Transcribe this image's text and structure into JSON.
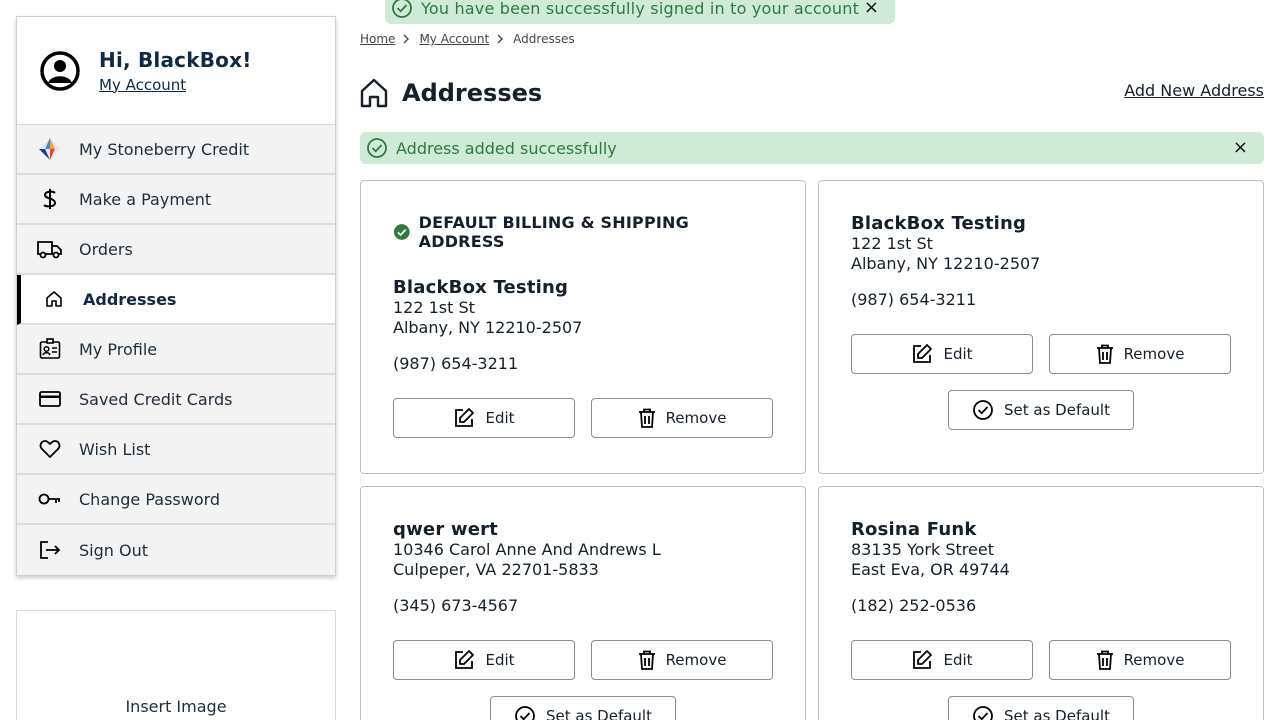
{
  "toast": {
    "message": "You have been successfully signed in to your account",
    "close": "×"
  },
  "sidebar": {
    "greeting": "Hi, BlackBox!",
    "account_link": "My Account",
    "items": [
      {
        "label": "My Stoneberry Credit",
        "icon": "stoneberry-logo-icon"
      },
      {
        "label": "Make a Payment",
        "icon": "dollar-icon"
      },
      {
        "label": "Orders",
        "icon": "truck-icon"
      },
      {
        "label": "Addresses",
        "icon": "home-icon"
      },
      {
        "label": "My Profile",
        "icon": "id-badge-icon"
      },
      {
        "label": "Saved Credit Cards",
        "icon": "credit-card-icon"
      },
      {
        "label": "Wish List",
        "icon": "heart-icon"
      },
      {
        "label": "Change Password",
        "icon": "key-icon"
      },
      {
        "label": "Sign Out",
        "icon": "sign-out-icon"
      }
    ],
    "insert_image": "Insert Image"
  },
  "breadcrumb": {
    "home": "Home",
    "account": "My Account",
    "current": "Addresses"
  },
  "page": {
    "title": "Addresses",
    "add_link": "Add New Address"
  },
  "alert": {
    "message": "Address added successfully",
    "close": "×"
  },
  "default_badge": "DEFAULT BILLING & SHIPPING ADDRESS",
  "buttons": {
    "edit": "Edit",
    "remove": "Remove",
    "set_default": "Set as Default"
  },
  "addresses": [
    {
      "name": "BlackBox Testing",
      "line1": "122 1st St",
      "line2": "Albany, NY 12210-2507",
      "phone": "(987) 654-3211"
    },
    {
      "name": "BlackBox Testing",
      "line1": "122 1st St",
      "line2": "Albany, NY 12210-2507",
      "phone": "(987) 654-3211"
    },
    {
      "name": "qwer wert",
      "line1": "10346 Carol Anne And Andrews L",
      "line2": "Culpeper, VA 22701-5833",
      "phone": "(345) 673-4567"
    },
    {
      "name": "Rosina Funk",
      "line1": "83135 York Street",
      "line2": "East Eva, OR 49744",
      "phone": "(182) 252-0536"
    }
  ],
  "colors": {
    "success_bg": "#cfead7",
    "success_text": "#2f7a3e",
    "brand_navy": "#102a43"
  }
}
